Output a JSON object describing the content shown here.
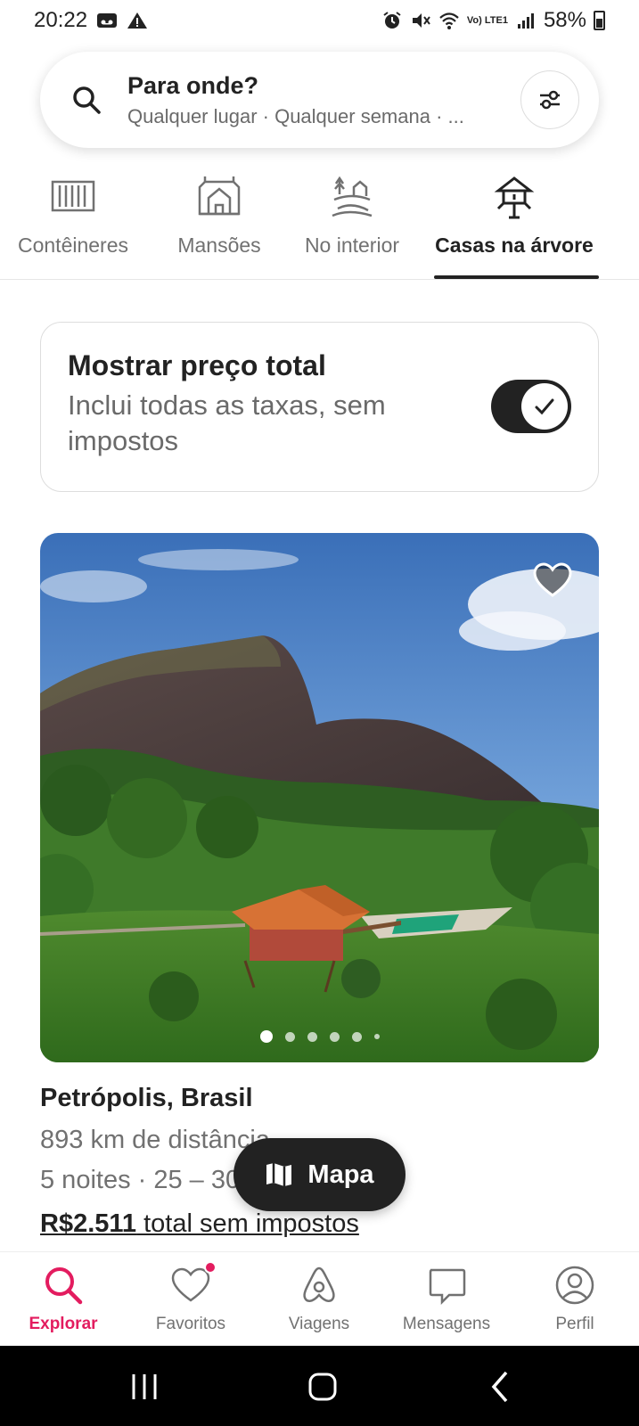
{
  "status_bar": {
    "time": "20:22",
    "battery": "58%",
    "network": "Vo) LTE1"
  },
  "search": {
    "title": "Para onde?",
    "subtitle": "Qualquer lugar · Qualquer semana · ...",
    "icon": "search-icon",
    "filter_icon": "filters-icon"
  },
  "categories": [
    {
      "label": "Contêineres",
      "icon": "container-icon",
      "active": false
    },
    {
      "label": "Mansões",
      "icon": "mansion-icon",
      "active": false
    },
    {
      "label": "No interior",
      "icon": "countryside-icon",
      "active": false
    },
    {
      "label": "Casas na árvore",
      "icon": "treehouse-icon",
      "active": true
    }
  ],
  "price_toggle": {
    "title": "Mostrar preço total",
    "subtitle": "Inclui todas as taxas, sem impostos",
    "enabled": true
  },
  "listing": {
    "location": "Petrópolis, Brasil",
    "distance": "893 km de distância",
    "dates": "5 noites · 25 – 30",
    "price_amount": "R$2.511",
    "price_suffix": " total sem impostos",
    "photo_count_visible": 6,
    "active_photo": 1
  },
  "map_button": {
    "label": "Mapa",
    "icon": "map-icon"
  },
  "bottom_nav": [
    {
      "label": "Explorar",
      "icon": "search-icon",
      "active": true
    },
    {
      "label": "Favoritos",
      "icon": "heart-icon",
      "active": false,
      "badge": true
    },
    {
      "label": "Viagens",
      "icon": "airbnb-icon",
      "active": false
    },
    {
      "label": "Mensagens",
      "icon": "message-icon",
      "active": false
    },
    {
      "label": "Perfil",
      "icon": "profile-icon",
      "active": false
    }
  ],
  "colors": {
    "accent": "#e31c5f",
    "text": "#222222",
    "muted": "#717171"
  }
}
